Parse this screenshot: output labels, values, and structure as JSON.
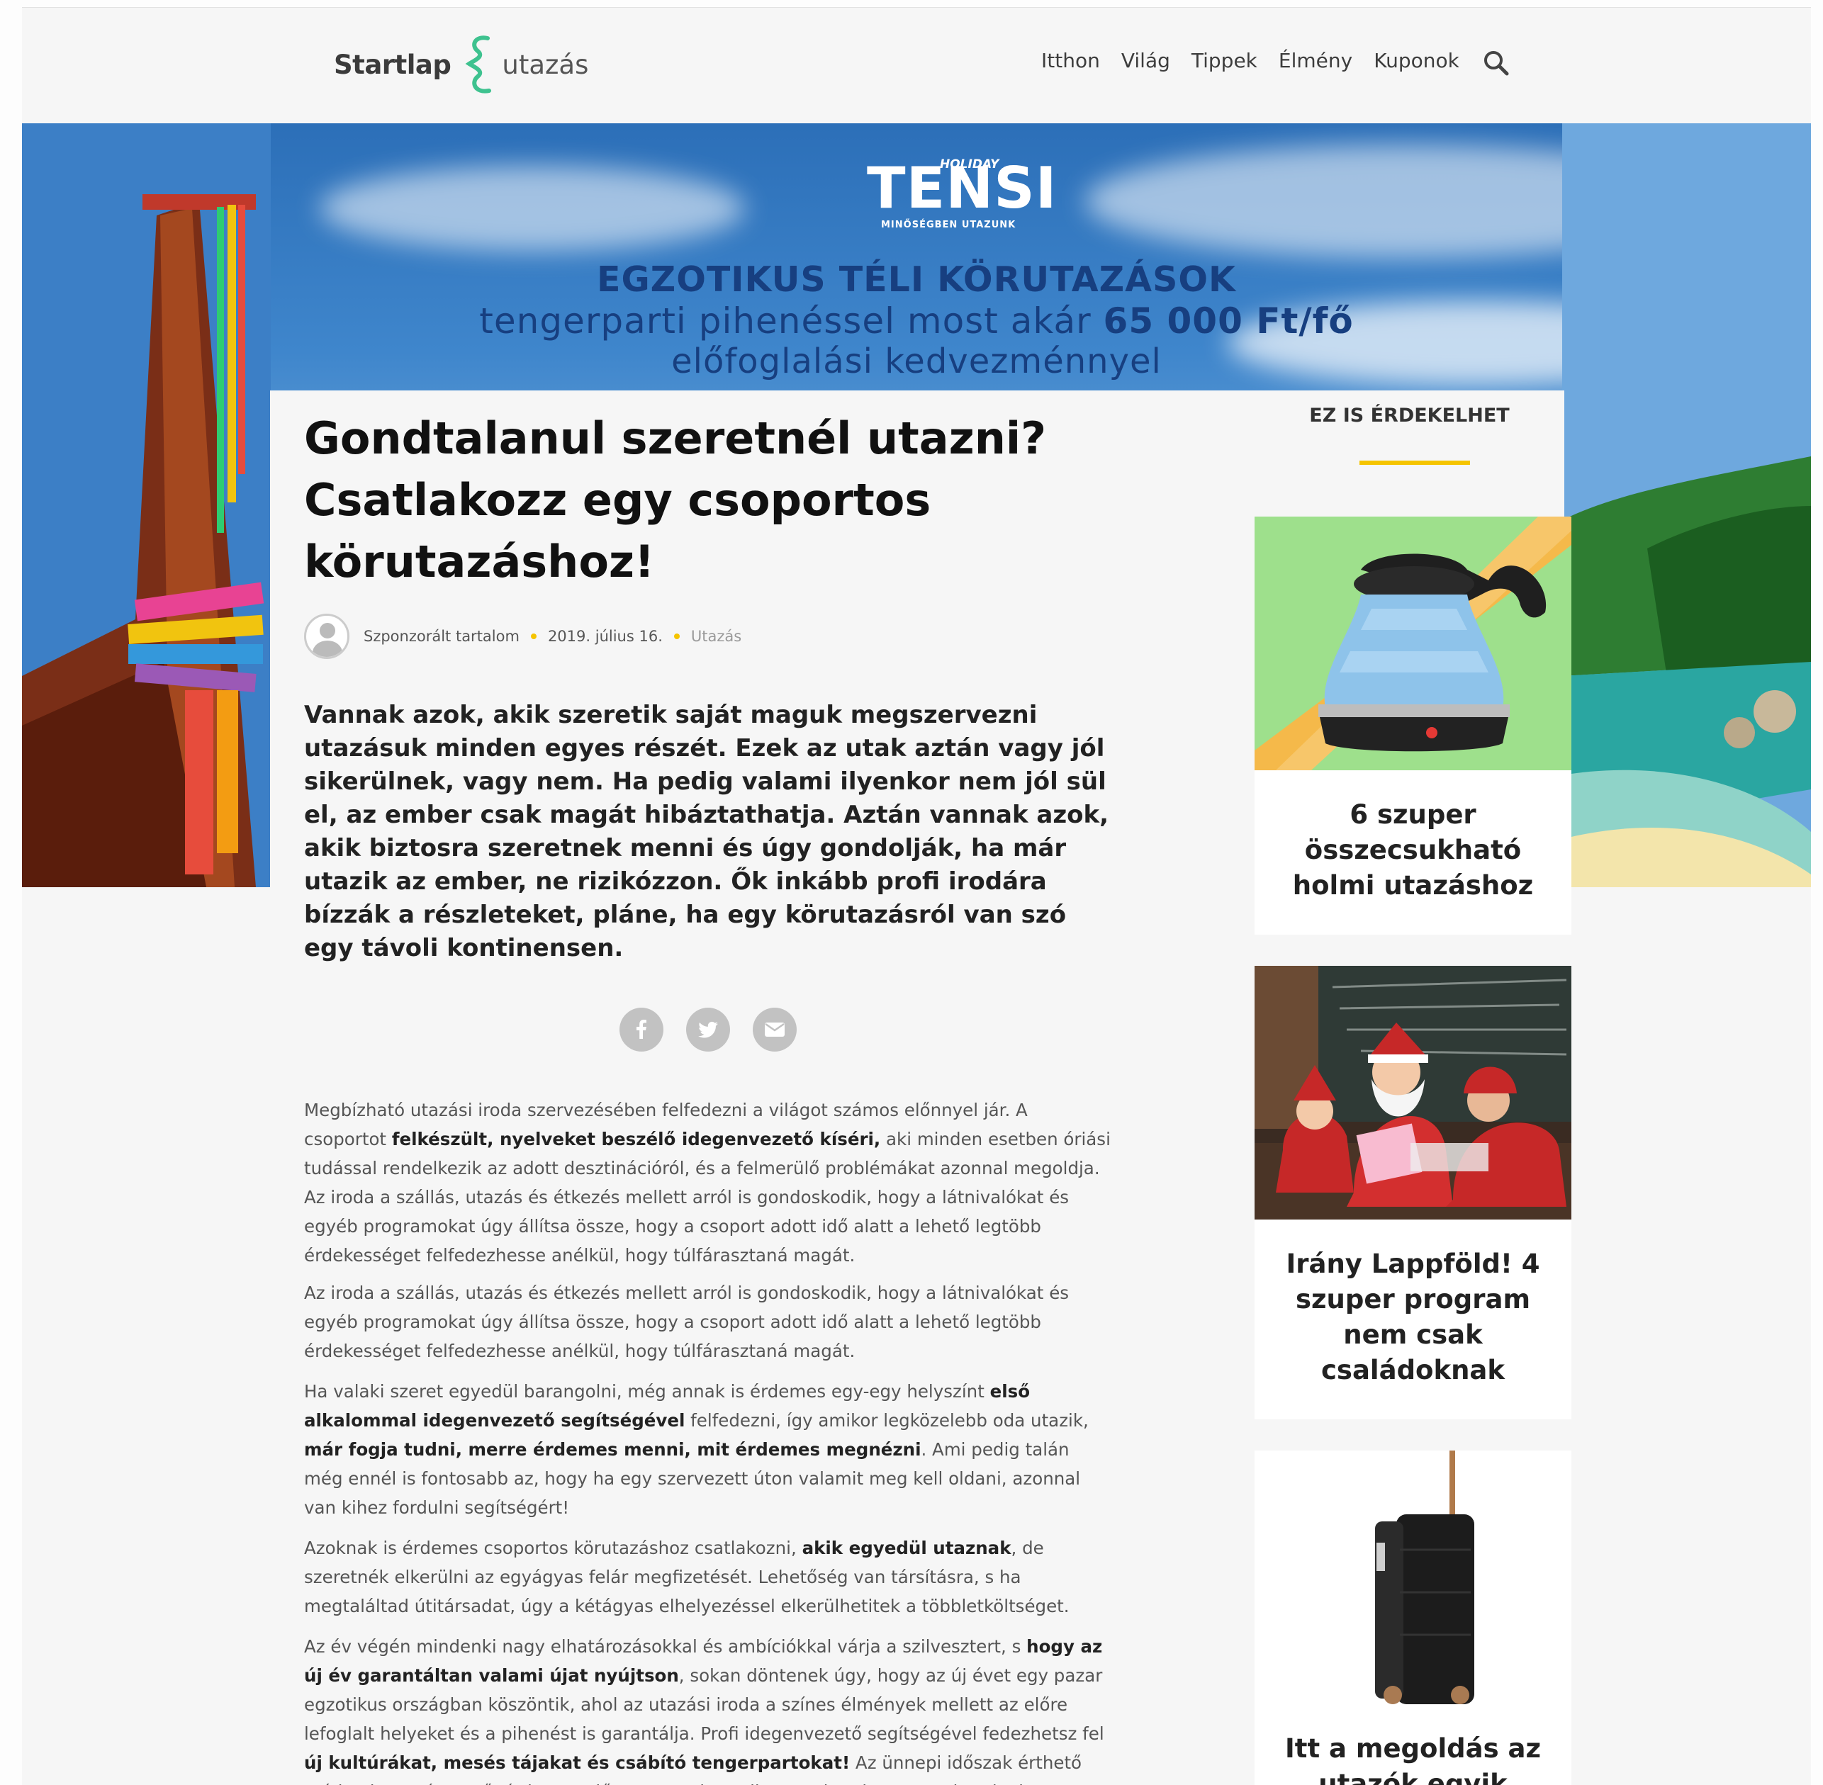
{
  "header": {
    "logo_part1": "Startlap",
    "logo_part2": "utazás",
    "nav": [
      "Itthon",
      "Világ",
      "Tippek",
      "Élmény",
      "Kuponok"
    ],
    "search_icon": "search-icon"
  },
  "banner": {
    "brand_small": "HOLIDAY",
    "brand_name": "TENSI",
    "brand_tagline": "MINŐSÉGBEN UTAZUNK",
    "line1": "EGZOTIKUS TÉLI KÖRUTAZÁSOK",
    "line2_a": "tengerparti pihenéssel most akár ",
    "line2_b": "65 000 Ft/fő",
    "line3": "előfoglalási kedvezménnyel"
  },
  "article": {
    "title": "Gondtalanul szeretnél utazni? Csatlakozz egy csoportos körutazáshoz!",
    "author": "Szponzorált tartalom",
    "date": "2019. július 16.",
    "category": "Utazás",
    "lead": "Vannak azok, akik szeretik saját maguk megszervezni utazásuk minden egyes részét. Ezek az utak aztán vagy jól sikerülnek, vagy nem. Ha pedig valami ilyenkor nem jól sül el, az ember csak magát hibáztathatja. Aztán vannak azok, akik biztosra szeretnek menni és úgy gondolják, ha már utazik az ember, ne rizikózzon. Ők inkább profi irodára bízzák a részleteket, pláne, ha egy körutazásról van szó egy távoli kontinensen.",
    "share": [
      "facebook-icon",
      "twitter-icon",
      "email-icon"
    ],
    "p1_a": "Megbízható utazási iroda szervezésében felfedezni a világot számos előnnyel jár. A csoportot ",
    "p1_b": "felkészült, nyelveket beszélő idegenvezető kíséri,",
    "p1_c": " aki minden esetben óriási tudással rendelkezik az adott desztinációról, és a felmerülő problémákat azonnal megoldja.",
    "p1_d": "Az iroda a szállás, utazás és étkezés mellett arról is gondoskodik, hogy a látnivalókat és egyéb programokat úgy állítsa össze, hogy a csoport adott idő alatt a lehető legtöbb érdekességet felfedezhesse anélkül, hogy túlfárasztaná magát.",
    "p2": "Az iroda a szállás, utazás és étkezés mellett arról is gondoskodik, hogy a látnivalókat és egyéb programokat úgy állítsa össze, hogy a csoport adott idő alatt a lehető legtöbb érdekességet felfedezhesse anélkül, hogy túlfárasztaná magát.",
    "p3_a": "Ha valaki szeret egyedül barangolni, még annak is érdemes egy-egy helyszínt ",
    "p3_b": "első alkalommal idegenvezető segítségével",
    "p3_c": " felfedezni, így amikor legközelebb oda utazik, ",
    "p3_d": "már fogja tudni, merre érdemes menni, mit érdemes megnézni",
    "p3_e": ". Ami pedig talán még ennél is fontosabb az, hogy ha egy szervezett úton valamit meg kell oldani, azonnal van kihez fordulni segítségért!",
    "p4_a": "Azoknak is érdemes csoportos körutazáshoz csatlakozni, ",
    "p4_b": "akik egyedül utaznak",
    "p4_c": ", de szeretnék elkerülni az egyágyas felár megfizetését. Lehetőség van társításra, s ha megtaláltad útitársadat, úgy a kétágyas elhelyezéssel elkerülhetitek a többletköltséget.",
    "p5_a": "Az év végén mindenki nagy elhatározásokkal és ambíciókkal várja a szilvesztert, s ",
    "p5_b": "hogy az új év garantáltan valami újat nyújtson",
    "p5_c": ", sokan döntenek úgy, hogy az új évet egy pazar egzotikus országban köszöntik, ahol az utazási iroda a színes élmények mellett az előre lefoglalt helyeket és a pihenést is garantálja. Profi idegenvezető segítségével fedezhetsz fel ",
    "p5_d": "új kultúrákat, mesés tájakat és csábító tengerpartokat!",
    "p5_e": " Az ünnepi időszak érthető módon igen népszerű, érdemes előre tervezni, a szilveszteri utak gyorsan betelnek."
  },
  "sidebar": {
    "title": "EZ IS ÉRDEKELHET",
    "cards": [
      {
        "caption": "6 szuper összecsukható holmi utazáshoz",
        "image": "blue-folding-kettle",
        "accent": "#9ee08c"
      },
      {
        "caption": "Irány Lappföld! 4 szuper program nem csak családoknak",
        "image": "santa-claus-with-children",
        "accent": "#c62828"
      },
      {
        "caption": "Itt a megoldás az utazók egyik",
        "image": "black-rolling-suitcase",
        "accent": "#222222"
      }
    ]
  },
  "colors": {
    "accent_yellow": "#f5c400",
    "logo_green": "#3ec28f",
    "banner_text": "#173f80"
  }
}
